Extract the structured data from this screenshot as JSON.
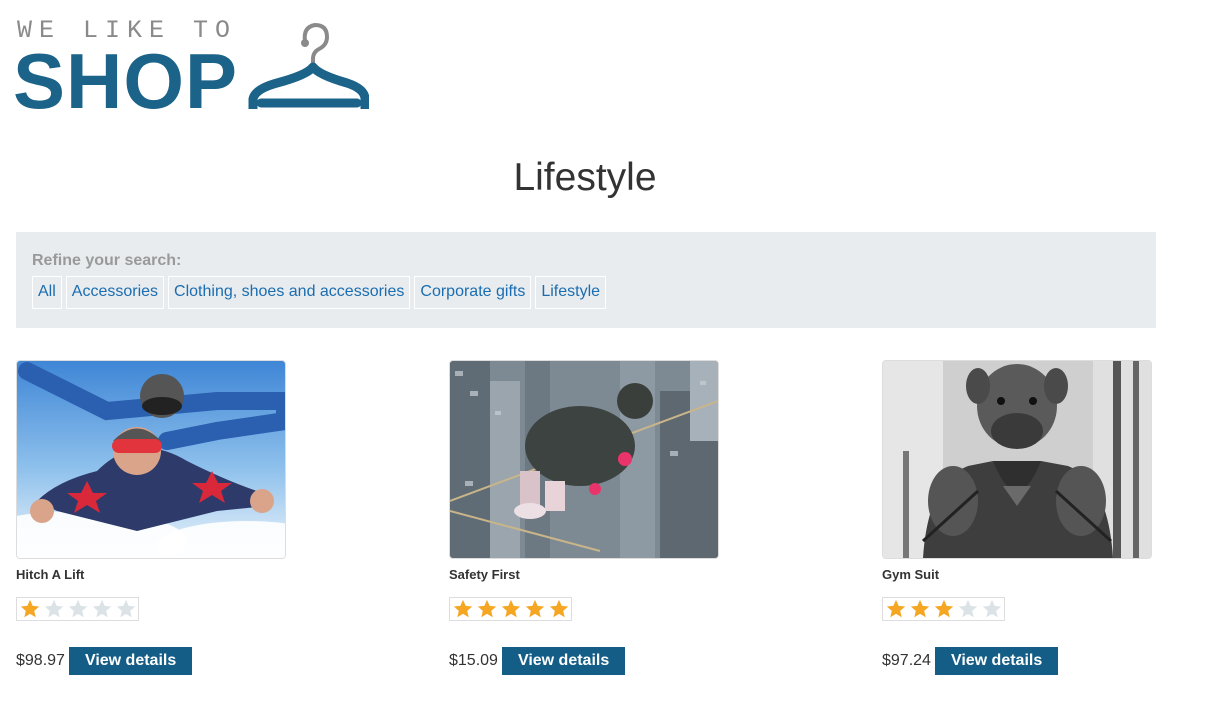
{
  "logo": {
    "line1": "WE LIKE TO",
    "line2": "SHOP",
    "icon": "clothes-hanger-icon"
  },
  "page_title": "Lifestyle",
  "filter": {
    "heading": "Refine your search:",
    "links": [
      "All",
      "Accessories",
      "Clothing, shoes and accessories",
      "Corporate gifts",
      "Lifestyle"
    ]
  },
  "products": [
    {
      "name": "Hitch A Lift",
      "rating": 1,
      "max_rating": 5,
      "price": "$98.97",
      "button": "View details",
      "image": "skydiving-photo"
    },
    {
      "name": "Safety First",
      "rating": 5,
      "max_rating": 5,
      "price": "$15.09",
      "button": "View details",
      "image": "tightrope-city-photo"
    },
    {
      "name": "Gym Suit",
      "rating": 3,
      "max_rating": 5,
      "price": "$97.24",
      "button": "View details",
      "image": "bulldog-gym-photo"
    }
  ],
  "colors": {
    "brand_blue": "#1b6388",
    "button_blue": "#135d86",
    "link_blue": "#1b6db0",
    "star_filled": "#f5a623",
    "star_empty": "#dce3e6",
    "panel_bg": "#e8ecef"
  }
}
